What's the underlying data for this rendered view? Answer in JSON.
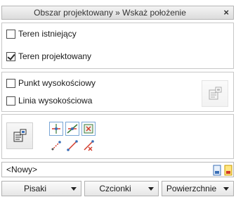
{
  "title": "Obszar projektowany » Wskaż położenie",
  "close_symbol": "×",
  "layers": {
    "existing_label": "Teren istniejący",
    "existing_checked": false,
    "designed_label": "Teren projektowany",
    "designed_checked": true
  },
  "elevation": {
    "point_label": "Punkt wysokościowy",
    "point_checked": false,
    "line_label": "Linia wysokościowa",
    "line_checked": false
  },
  "style_combo": {
    "value": "<Nowy>"
  },
  "buttons": {
    "pens": "Pisaki",
    "fonts": "Czcionki",
    "surfaces": "Powierzchnie"
  },
  "colors": {
    "accent": "#d23a2a",
    "tool_border": "#7aa7d6",
    "link_line": "#3a7a3a"
  }
}
